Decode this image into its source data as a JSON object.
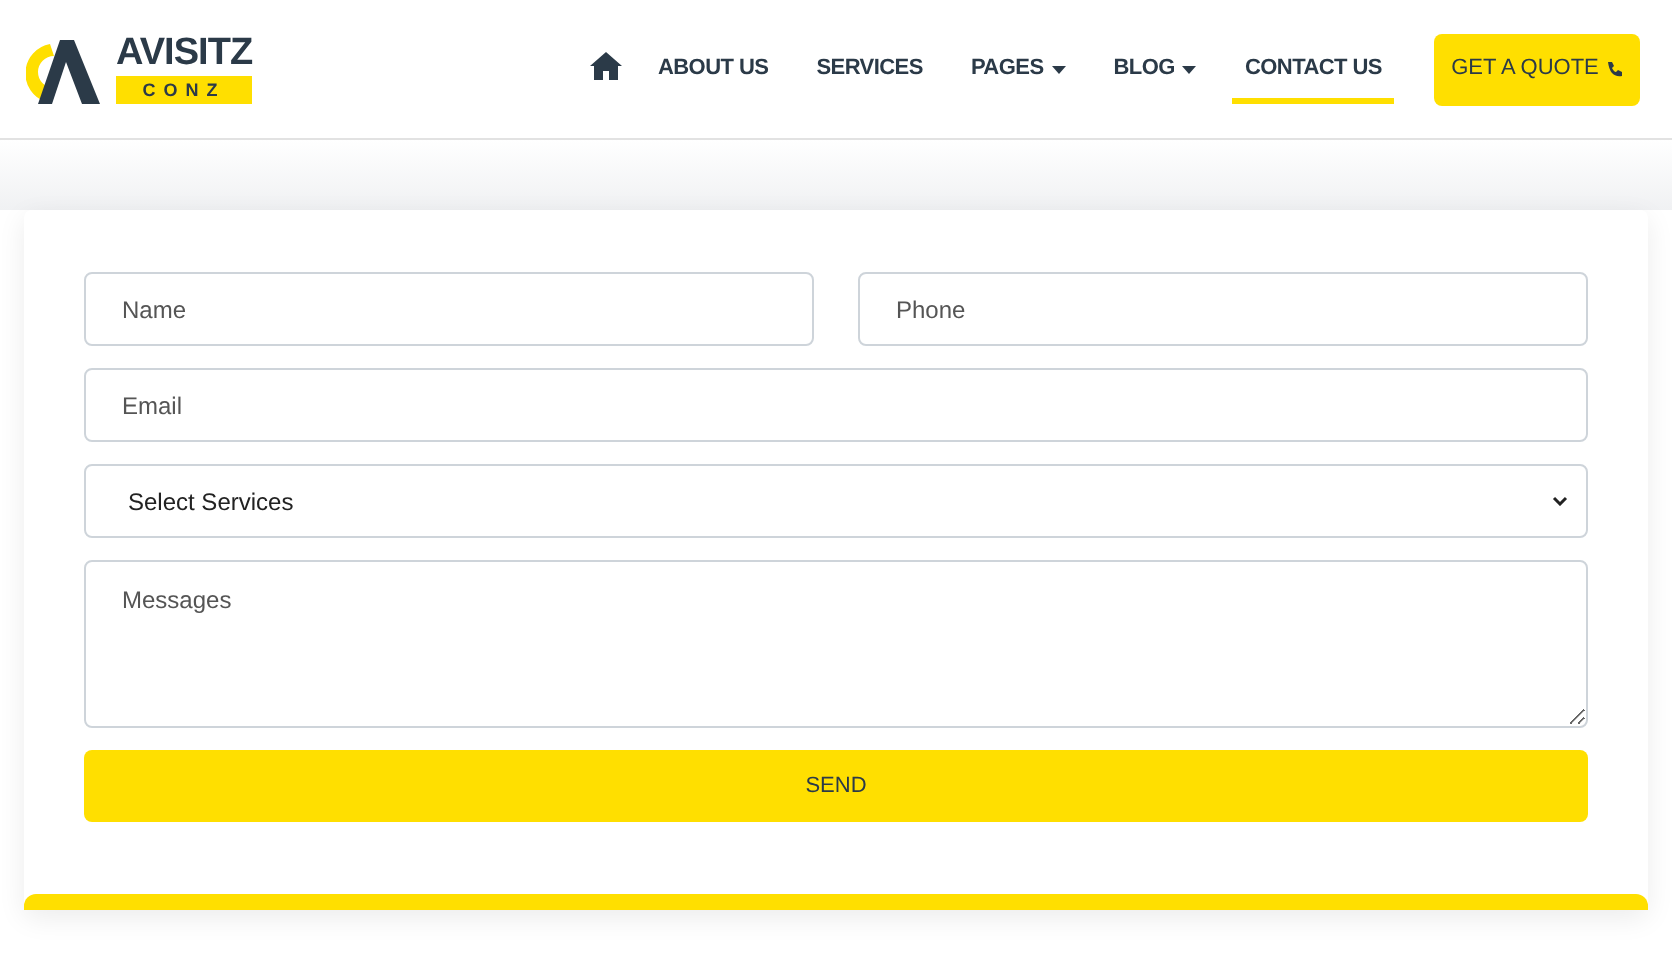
{
  "logo": {
    "title": "AVISITZ",
    "subtitle": "CONZ"
  },
  "nav": [
    {
      "kind": "home",
      "selected": false
    },
    {
      "kind": "link",
      "label": "ABOUT US",
      "selected": false
    },
    {
      "kind": "link",
      "label": "SERVICES",
      "selected": false
    },
    {
      "kind": "dropdown",
      "label": "PAGES",
      "selected": false
    },
    {
      "kind": "dropdown",
      "label": "BLOG",
      "selected": false
    },
    {
      "kind": "link",
      "label": "CONTACT US",
      "selected": true
    }
  ],
  "quote_button": {
    "label": "GET A QUOTE"
  },
  "form": {
    "name": {
      "placeholder": "Name"
    },
    "phone": {
      "placeholder": "Phone"
    },
    "email": {
      "placeholder": "Email"
    },
    "services": {
      "value": "Select Services"
    },
    "messages": {
      "placeholder": "Messages"
    },
    "send": "SEND"
  }
}
